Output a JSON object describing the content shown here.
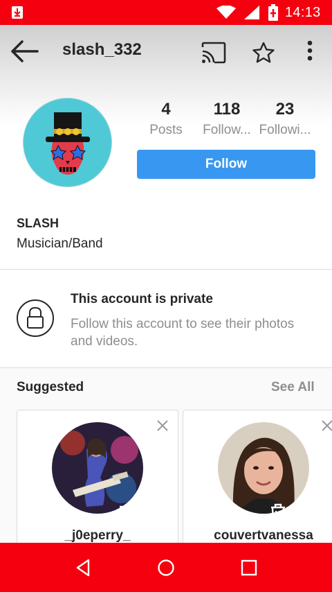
{
  "status_bar": {
    "time": "14:13",
    "icons": [
      "download-icon",
      "wifi-icon",
      "signal-icon",
      "battery-charging-icon"
    ]
  },
  "toolbar": {
    "username": "slash_332",
    "icons": [
      "back-arrow-icon",
      "cast-icon",
      "star-icon",
      "more-vert-icon"
    ]
  },
  "profile": {
    "stats": [
      {
        "value": "4",
        "label": "Posts"
      },
      {
        "value": "118",
        "label": "Follow..."
      },
      {
        "value": "23",
        "label": "Followi..."
      }
    ],
    "follow_label": "Follow",
    "name": "SLASH",
    "category": "Musician/Band"
  },
  "private_notice": {
    "title": "This account is private",
    "subtitle": "Follow this account to see their photos and videos."
  },
  "suggested": {
    "title": "Suggested",
    "see_all_label": "See All",
    "cards": [
      {
        "username": "_j0eperry_"
      },
      {
        "username": "couvertvanessa"
      }
    ]
  },
  "overlay_icons": [
    "share-icon",
    "tune-icon",
    "screenshot-lens-icon",
    "delete-icon"
  ],
  "nav_bar": {
    "icons": [
      "nav-back-icon",
      "nav-home-icon",
      "nav-recents-icon"
    ]
  },
  "colors": {
    "system_bars": "#f5000f",
    "follow_button": "#3897f0",
    "avatar_bg": "#4fc9d6"
  }
}
